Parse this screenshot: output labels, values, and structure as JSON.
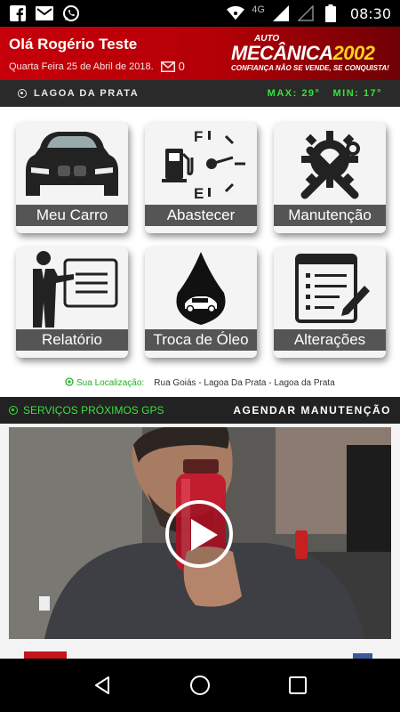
{
  "status_bar": {
    "network": "4G",
    "time": "08:30",
    "icons": [
      "facebook-icon",
      "gmail-icon",
      "whatsapp-icon",
      "wifi-icon",
      "signal-icon",
      "battery-icon"
    ]
  },
  "header": {
    "greeting": "Olá Rogério Teste",
    "date": "Quarta Feira 25 de Abril de 2018.",
    "mail_count": "0",
    "logo": {
      "prefix": "AUTO",
      "name": "MECÂNICA",
      "year": "2002",
      "slogan": "CONFIANÇA NÃO SE VENDE, SE CONQUISTA!"
    }
  },
  "weather": {
    "city": "LAGOA DA PRATA",
    "max": "MAX: 29°",
    "min": "MIN: 17°"
  },
  "menu": {
    "items": [
      {
        "label": "Meu Carro",
        "icon": "car-icon"
      },
      {
        "label": "Abastecer",
        "icon": "fuel-gauge-icon"
      },
      {
        "label": "Manutenção",
        "icon": "tools-gear-icon"
      },
      {
        "label": "Relatório",
        "icon": "presentation-icon"
      },
      {
        "label": "Troca de Óleo",
        "icon": "oil-drop-icon"
      },
      {
        "label": "Alterações",
        "icon": "document-edit-icon"
      }
    ]
  },
  "location": {
    "label": "Sua Localização:",
    "address": "Rua Goiás - Lagoa Da Prata - Lagoa da Prata"
  },
  "services_bar": {
    "services": "SERVIÇOS PRÓXIMOS GPS",
    "schedule": "AGENDAR MANUTENÇÃO"
  },
  "colors": {
    "header_red": "#c7000a",
    "accent_green": "#36e23a",
    "logo_yellow": "#ffd11a",
    "tile_label_bg": "#555555"
  }
}
